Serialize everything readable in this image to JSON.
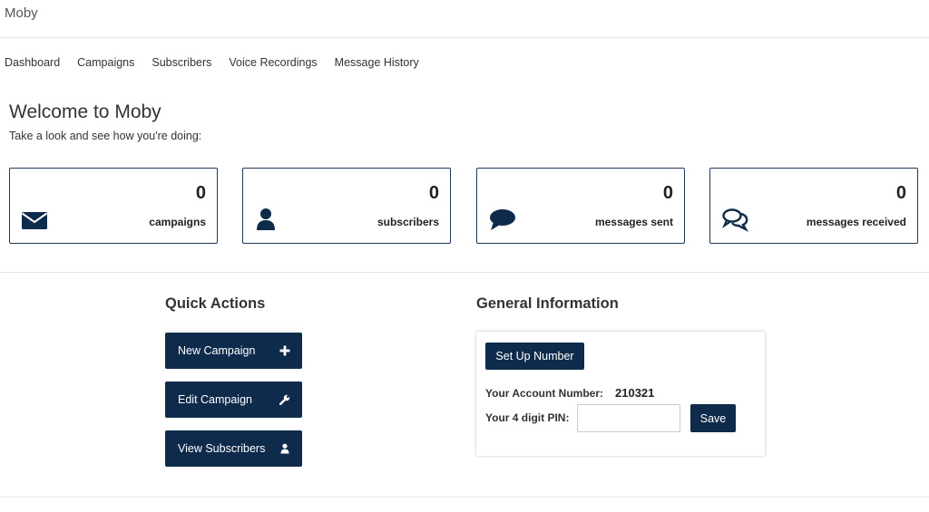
{
  "app": {
    "brand": "Moby"
  },
  "nav": {
    "items": [
      {
        "label": "Dashboard"
      },
      {
        "label": "Campaigns"
      },
      {
        "label": "Subscribers"
      },
      {
        "label": "Voice Recordings"
      },
      {
        "label": "Message History"
      }
    ]
  },
  "welcome": {
    "title": "Welcome to Moby",
    "subtitle": "Take a look and see how you're doing:"
  },
  "stats": [
    {
      "value": "0",
      "label": "campaigns",
      "icon": "envelope-icon"
    },
    {
      "value": "0",
      "label": "subscribers",
      "icon": "user-icon"
    },
    {
      "value": "0",
      "label": "messages sent",
      "icon": "comment-icon"
    },
    {
      "value": "0",
      "label": "messages received",
      "icon": "comments-icon"
    }
  ],
  "quick_actions": {
    "title": "Quick Actions",
    "buttons": [
      {
        "label": "New Campaign",
        "icon": "plus-icon"
      },
      {
        "label": "Edit Campaign",
        "icon": "wrench-icon"
      },
      {
        "label": "View Subscribers",
        "icon": "user-icon"
      }
    ]
  },
  "general_info": {
    "title": "General Information",
    "setup_button": "Set Up Number",
    "account_label": "Your Account Number:",
    "account_number": "210321",
    "pin_label": "Your 4 digit PIN:",
    "pin_value": "",
    "save_button": "Save"
  },
  "colors": {
    "primary": "#0f2b4c",
    "card_border": "#1f3a5f"
  }
}
